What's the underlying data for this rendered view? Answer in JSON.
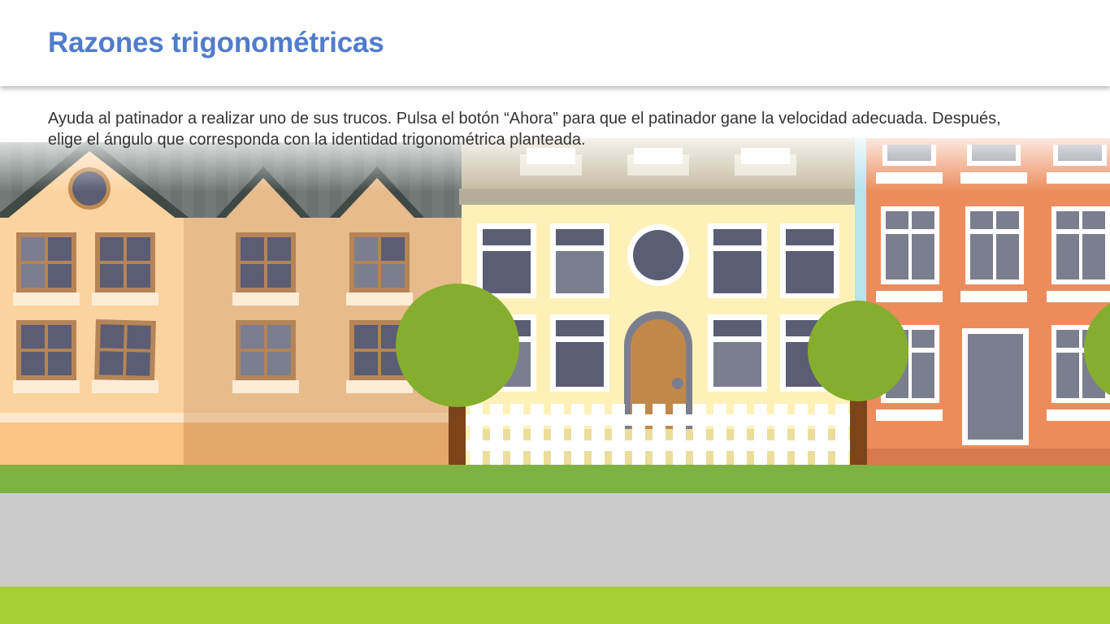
{
  "title": "Razones trigonométricas",
  "instructions": "Ayuda al patinador a realizar uno de sus trucos. Pulsa el botón “Ahora” para que el patinador gane la velocidad adecuada. Después, elige el ángulo que corresponda con la identidad trigonométrica planteada.",
  "colors": {
    "title": "#4f7ccc",
    "grass": "#7cb342",
    "road": "#cbcbcb",
    "lower_grass": "#a6cf35",
    "tree": "#86ae2e",
    "house_yellow": "#fdf1b8",
    "house_orange": "#ec8c5c",
    "house_peach": "#fcd39e",
    "house_tan": "#e8bb8c"
  },
  "scene": {
    "icons": [
      "house-icon",
      "tree-icon",
      "fence-icon",
      "door-icon",
      "window-icon"
    ]
  }
}
